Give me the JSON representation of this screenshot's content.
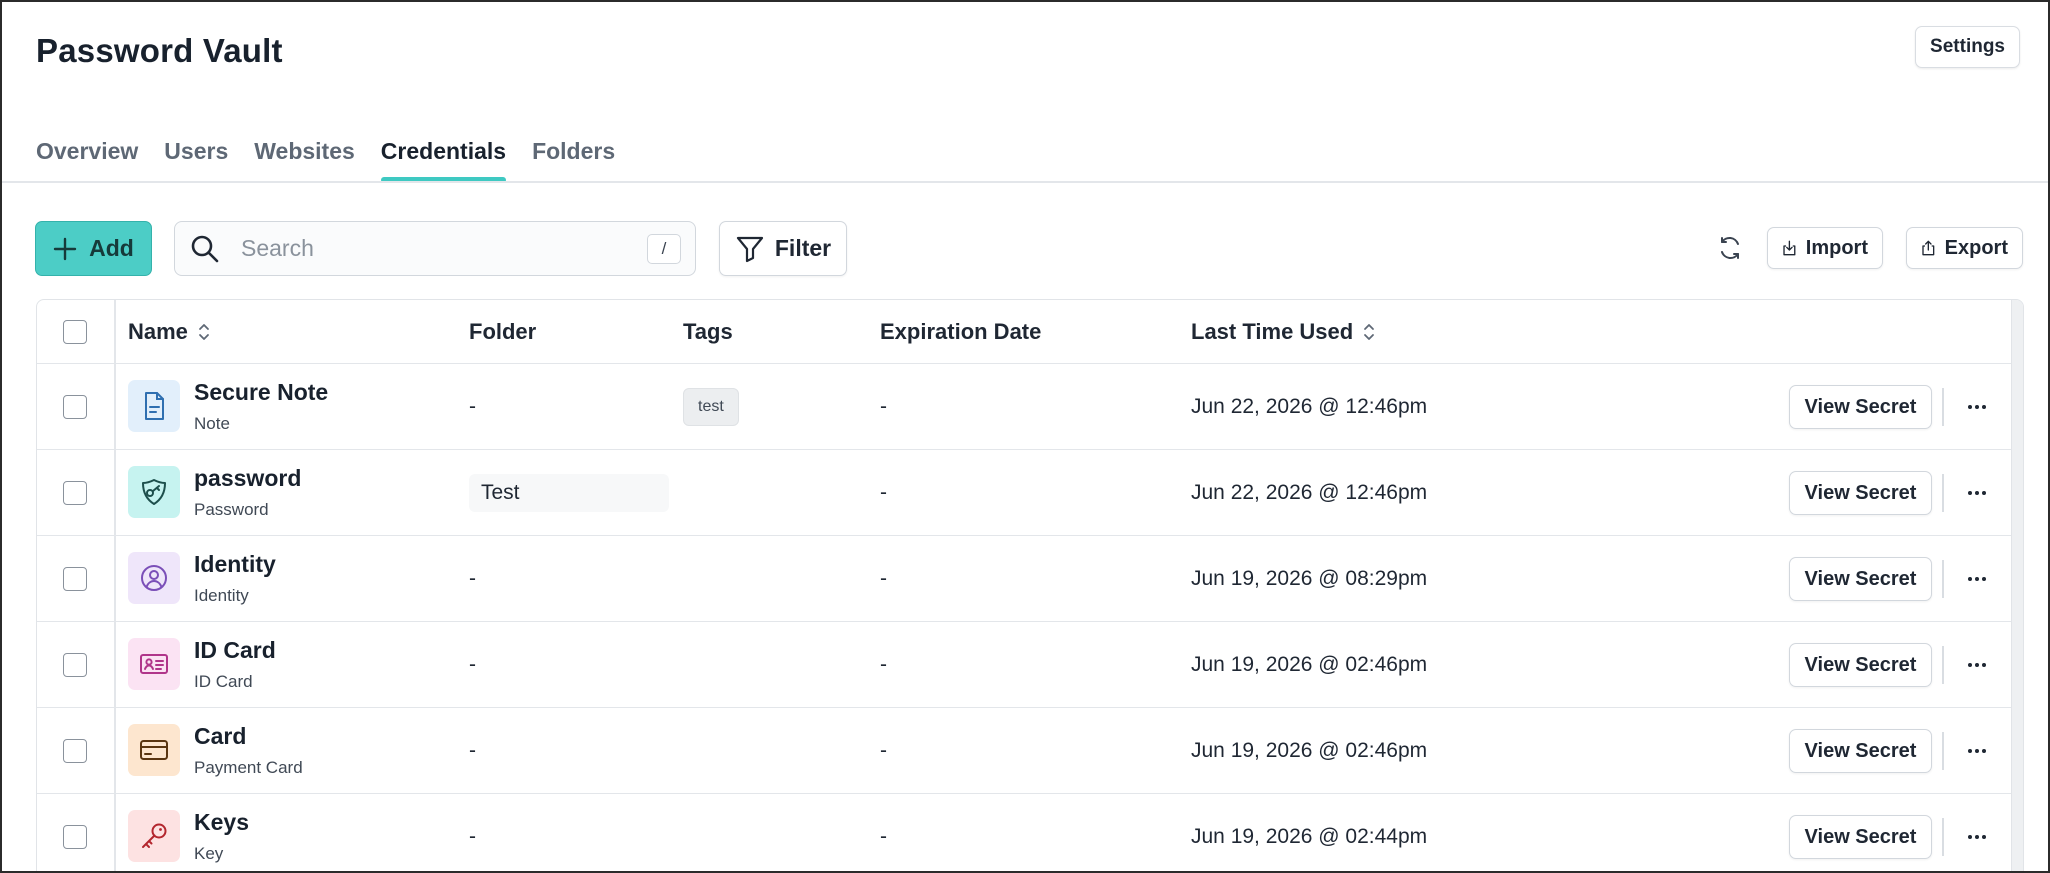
{
  "app": {
    "title": "Password Vault",
    "settings_label": "Settings"
  },
  "tabs": [
    {
      "label": "Overview",
      "active": false
    },
    {
      "label": "Users",
      "active": false
    },
    {
      "label": "Websites",
      "active": false
    },
    {
      "label": "Credentials",
      "active": true
    },
    {
      "label": "Folders",
      "active": false
    }
  ],
  "toolbar": {
    "add_label": "Add",
    "search_placeholder": "Search",
    "search_value": "",
    "search_shortcut": "/",
    "filter_label": "Filter",
    "import_label": "Import",
    "export_label": "Export"
  },
  "table": {
    "columns": {
      "name": "Name",
      "folder": "Folder",
      "tags": "Tags",
      "expiration": "Expiration Date",
      "last_used": "Last Time Used"
    },
    "view_secret_label": "View Secret",
    "rows": [
      {
        "name": "Secure Note",
        "type": "Note",
        "icon": "note-icon",
        "folder": "-",
        "tag": "test",
        "expiration": "-",
        "last_used": "Jun 22, 2026 @ 12:46pm"
      },
      {
        "name": "password",
        "type": "Password",
        "icon": "password-icon",
        "folder": "Test",
        "tag": "",
        "expiration": "-",
        "last_used": "Jun 22, 2026 @ 12:46pm"
      },
      {
        "name": "Identity",
        "type": "Identity",
        "icon": "identity-icon",
        "folder": "-",
        "tag": "",
        "expiration": "-",
        "last_used": "Jun 19, 2026 @ 08:29pm"
      },
      {
        "name": "ID Card",
        "type": "ID Card",
        "icon": "id-card-icon",
        "folder": "-",
        "tag": "",
        "expiration": "-",
        "last_used": "Jun 19, 2026 @ 02:46pm"
      },
      {
        "name": "Card",
        "type": "Payment Card",
        "icon": "payment-card-icon",
        "folder": "-",
        "tag": "",
        "expiration": "-",
        "last_used": "Jun 19, 2026 @ 02:46pm"
      },
      {
        "name": "Keys",
        "type": "Key",
        "icon": "key-icon",
        "folder": "-",
        "tag": "",
        "expiration": "-",
        "last_used": "Jun 19, 2026 @ 02:44pm"
      }
    ]
  },
  "colors": {
    "accent": "#4ccdc6",
    "tab_underline": "#3ec9c2"
  }
}
